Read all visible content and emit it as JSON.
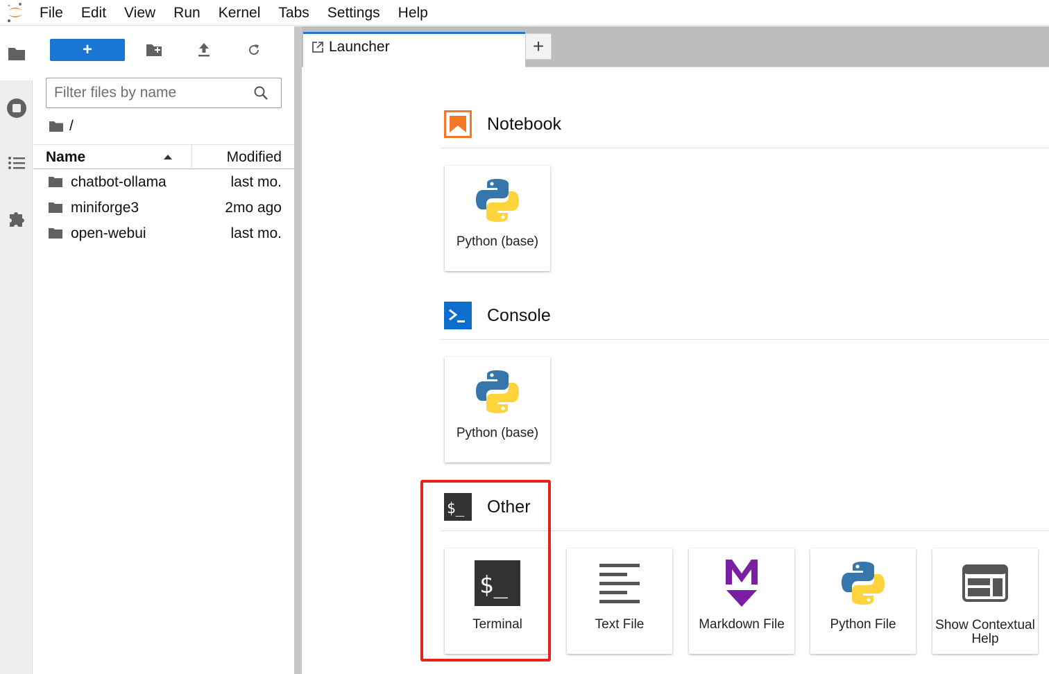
{
  "menubar": {
    "items": [
      "File",
      "Edit",
      "View",
      "Run",
      "Kernel",
      "Tabs",
      "Settings",
      "Help"
    ]
  },
  "activity_bar": {
    "icons": [
      "folder-icon",
      "running-icon",
      "toc-icon",
      "extension-icon"
    ]
  },
  "file_browser": {
    "new_button_label": "+",
    "filter_placeholder": "Filter files by name",
    "breadcrumb": "/",
    "columns": {
      "name": "Name",
      "modified": "Modified"
    },
    "rows": [
      {
        "name": "chatbot-ollama",
        "modified": "last mo."
      },
      {
        "name": "miniforge3",
        "modified": "2mo ago"
      },
      {
        "name": "open-webui",
        "modified": "last mo."
      }
    ]
  },
  "tabs": {
    "items": [
      {
        "label": "Launcher"
      }
    ],
    "add_label": "+"
  },
  "launcher": {
    "sections": {
      "notebook": {
        "title": "Notebook",
        "cards": [
          "Python (base)"
        ]
      },
      "console": {
        "title": "Console",
        "cards": [
          "Python (base)"
        ]
      },
      "other": {
        "title": "Other",
        "cards": [
          "Terminal",
          "Text File",
          "Markdown File",
          "Python File",
          "Show Contextual Help"
        ]
      }
    }
  },
  "colors": {
    "accent": "#1976d2",
    "notebook_orange": "#f37726",
    "highlight_red": "#e3231c",
    "markdown_purple": "#7b1fa2"
  }
}
